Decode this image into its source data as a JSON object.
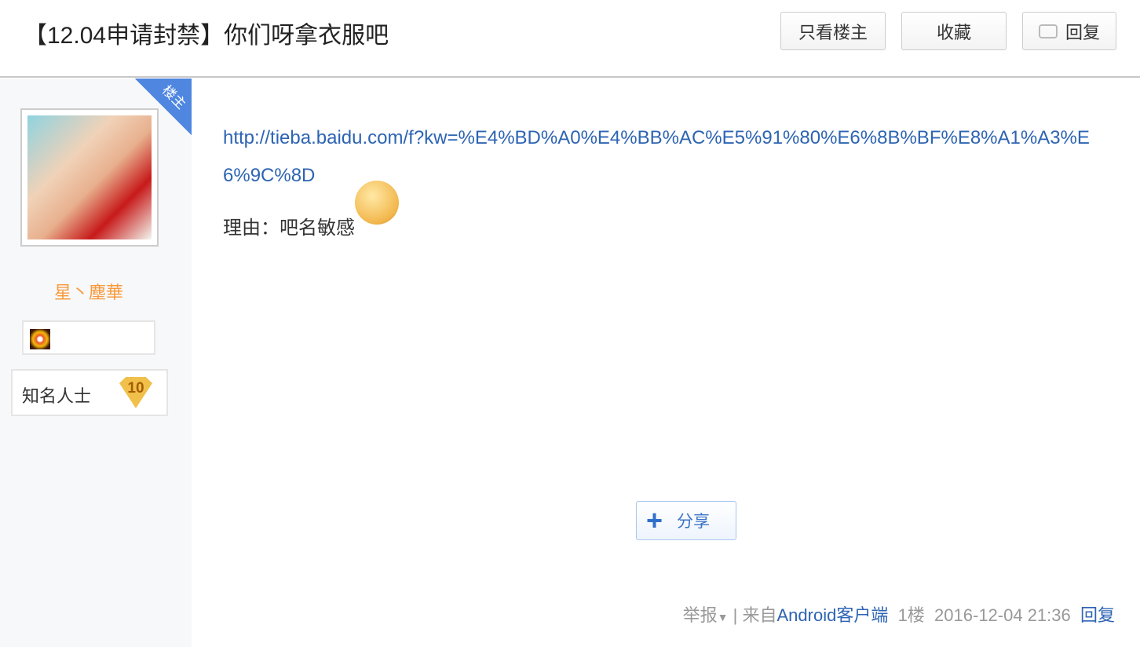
{
  "header": {
    "title": "【12.04申请封禁】你们呀拿衣服吧",
    "only_op": "只看楼主",
    "favorite": "收藏",
    "reply": "回复"
  },
  "author": {
    "corner_badge": "楼主",
    "name": "星丶塵華",
    "title": "知名人士",
    "level": "10"
  },
  "post": {
    "link": "http://tieba.baidu.com/f?kw=%E4%BD%A0%E4%BB%AC%E5%91%80%E6%8B%BF%E8%A1%A3%E6%9C%8D",
    "reason": "理由：吧名敏感"
  },
  "share": {
    "label": "分享"
  },
  "footer": {
    "report": "举报",
    "from_prefix": "来自",
    "client": "Android客户端",
    "floor": "1楼",
    "time": "2016-12-04 21:36",
    "reply": "回复"
  }
}
